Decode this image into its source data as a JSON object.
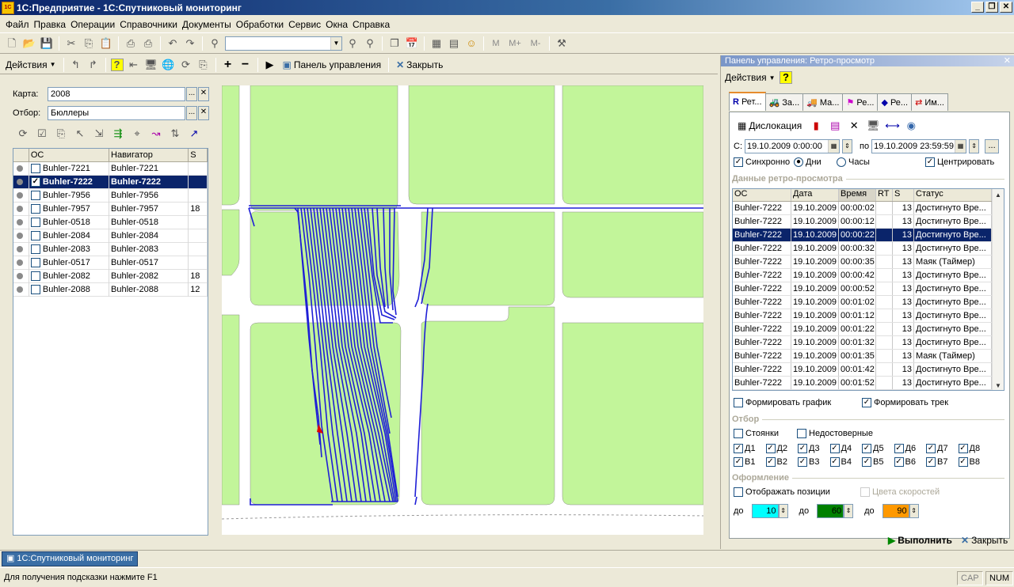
{
  "window": {
    "title": "1С:Предприятие - 1С:Спутниковый мониторинг"
  },
  "menu": [
    "Файл",
    "Правка",
    "Операции",
    "Справочники",
    "Документы",
    "Обработки",
    "Сервис",
    "Окна",
    "Справка"
  ],
  "toolbar": {
    "m": "M",
    "mplus": "M+",
    "mminus": "M-"
  },
  "left": {
    "actions_label": "Действия",
    "panel_label": "Панель управления",
    "close_label": "Закрыть",
    "map_label": "Карта:",
    "map_value": "2008",
    "filter_label": "Отбор:",
    "filter_value": "Бюллеры",
    "ellipsis": "...",
    "clear": "✕",
    "columns": [
      "ОС",
      "Навигатор",
      "S"
    ],
    "rows": [
      {
        "os": "Buhler-7221",
        "nav": "Buhler-7221",
        "s": "",
        "checked": false,
        "selected": false
      },
      {
        "os": "Buhler-7222",
        "nav": "Buhler-7222",
        "s": "",
        "checked": true,
        "selected": true
      },
      {
        "os": "Buhler-7956",
        "nav": "Buhler-7956",
        "s": "",
        "checked": false,
        "selected": false
      },
      {
        "os": "Buhler-7957",
        "nav": "Buhler-7957",
        "s": "18",
        "checked": false,
        "selected": false
      },
      {
        "os": "Buhler-0518",
        "nav": "Buhler-0518",
        "s": "",
        "checked": false,
        "selected": false
      },
      {
        "os": "Buhler-2084",
        "nav": "Buhler-2084",
        "s": "",
        "checked": false,
        "selected": false
      },
      {
        "os": "Buhler-2083",
        "nav": "Buhler-2083",
        "s": "",
        "checked": false,
        "selected": false
      },
      {
        "os": "Buhler-0517",
        "nav": "Buhler-0517",
        "s": "",
        "checked": false,
        "selected": false
      },
      {
        "os": "Buhler-2082",
        "nav": "Buhler-2082",
        "s": "18",
        "checked": false,
        "selected": false
      },
      {
        "os": "Buhler-2088",
        "nav": "Buhler-2088",
        "s": "12",
        "checked": false,
        "selected": false
      }
    ]
  },
  "right": {
    "title": "Панель управления: Ретро-просмотр",
    "actions_label": "Действия",
    "tabs": [
      "Рет...",
      "За...",
      "Ма...",
      "Ре...",
      "Ре...",
      "Им..."
    ],
    "dislocation_label": "Дислокация",
    "from_label": "С:",
    "from_value": "19.10.2009  0:00:00",
    "to_label": "по",
    "to_value": "19.10.2009 23:59:59",
    "sync_label": "Синхронно",
    "days_label": "Дни",
    "hours_label": "Часы",
    "center_label": "Центрировать",
    "retro_group": "Данные ретро-просмотра",
    "columns": [
      "ОС",
      "Дата",
      "Время",
      "RT",
      "S",
      "Статус"
    ],
    "rows": [
      {
        "os": "Buhler-7222",
        "date": "19.10.2009",
        "time": "00:00:02",
        "rt": "",
        "s": "13",
        "status": "Достигнуто Вре..."
      },
      {
        "os": "Buhler-7222",
        "date": "19.10.2009",
        "time": "00:00:12",
        "rt": "",
        "s": "13",
        "status": "Достигнуто Вре..."
      },
      {
        "os": "Buhler-7222",
        "date": "19.10.2009",
        "time": "00:00:22",
        "rt": "",
        "s": "13",
        "status": "Достигнуто Вре..."
      },
      {
        "os": "Buhler-7222",
        "date": "19.10.2009",
        "time": "00:00:32",
        "rt": "",
        "s": "13",
        "status": "Достигнуто Вре..."
      },
      {
        "os": "Buhler-7222",
        "date": "19.10.2009",
        "time": "00:00:35",
        "rt": "",
        "s": "13",
        "status": "Маяк (Таймер)"
      },
      {
        "os": "Buhler-7222",
        "date": "19.10.2009",
        "time": "00:00:42",
        "rt": "",
        "s": "13",
        "status": "Достигнуто Вре..."
      },
      {
        "os": "Buhler-7222",
        "date": "19.10.2009",
        "time": "00:00:52",
        "rt": "",
        "s": "13",
        "status": "Достигнуто Вре..."
      },
      {
        "os": "Buhler-7222",
        "date": "19.10.2009",
        "time": "00:01:02",
        "rt": "",
        "s": "13",
        "status": "Достигнуто Вре..."
      },
      {
        "os": "Buhler-7222",
        "date": "19.10.2009",
        "time": "00:01:12",
        "rt": "",
        "s": "13",
        "status": "Достигнуто Вре..."
      },
      {
        "os": "Buhler-7222",
        "date": "19.10.2009",
        "time": "00:01:22",
        "rt": "",
        "s": "13",
        "status": "Достигнуто Вре..."
      },
      {
        "os": "Buhler-7222",
        "date": "19.10.2009",
        "time": "00:01:32",
        "rt": "",
        "s": "13",
        "status": "Достигнуто Вре..."
      },
      {
        "os": "Buhler-7222",
        "date": "19.10.2009",
        "time": "00:01:35",
        "rt": "",
        "s": "13",
        "status": "Маяк (Таймер)"
      },
      {
        "os": "Buhler-7222",
        "date": "19.10.2009",
        "time": "00:01:42",
        "rt": "",
        "s": "13",
        "status": "Достигнуто Вре..."
      },
      {
        "os": "Buhler-7222",
        "date": "19.10.2009",
        "time": "00:01:52",
        "rt": "",
        "s": "13",
        "status": "Достигнуто Вре..."
      }
    ],
    "selected_row": 2,
    "graph_label": "Формировать график",
    "track_label": "Формировать трек",
    "filter_group": "Отбор",
    "stops_label": "Стоянки",
    "unreliable_label": "Недостоверные",
    "d_labels": [
      "Д1",
      "Д2",
      "Д3",
      "Д4",
      "Д5",
      "Д6",
      "Д7",
      "Д8"
    ],
    "v_labels": [
      "В1",
      "В2",
      "В3",
      "В4",
      "В5",
      "В6",
      "В7",
      "В8"
    ],
    "design_group": "Оформление",
    "show_pos_label": "Отображать позиции",
    "speed_colors_label": "Цвета скоростей",
    "to_short": "до",
    "speed1": "10",
    "speed1_color": "#00FFFF",
    "speed2": "60",
    "speed2_color": "#008000",
    "speed3": "90",
    "speed3_color": "#FF9900",
    "run_label": "Выполнить",
    "close_label": "Закрыть"
  },
  "taskbar": {
    "item": "1С:Спутниковый мониторинг"
  },
  "status": {
    "hint": "Для получения подсказки нажмите F1",
    "cap": "CAP",
    "num": "NUM"
  }
}
